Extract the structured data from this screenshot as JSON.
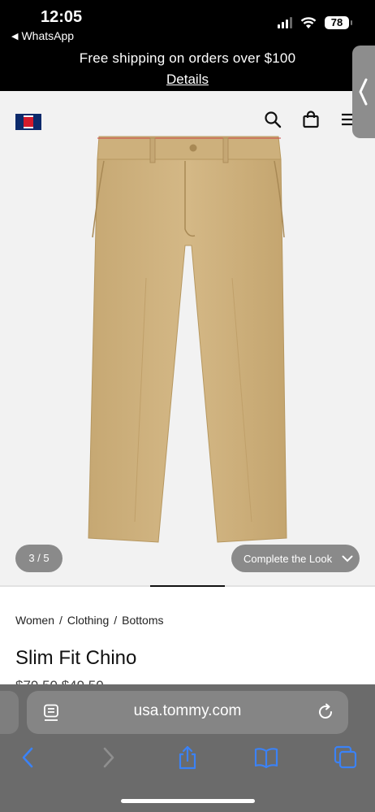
{
  "status_bar": {
    "time": "12:05",
    "back_app": "WhatsApp",
    "battery": "78"
  },
  "promo": {
    "message": "Free shipping on orders over $100",
    "link": "Details"
  },
  "gallery": {
    "counter": "3 / 5",
    "complete_look": "Complete the Look",
    "current_image": 3,
    "total_images": 5
  },
  "breadcrumb": {
    "items": [
      "Women",
      "Clothing",
      "Bottoms"
    ],
    "separator": "/"
  },
  "product": {
    "name": "Slim Fit Chino",
    "price_partial": "$79.50 $49.50"
  },
  "browser": {
    "url": "usa.tommy.com"
  },
  "icons": {
    "search": "search-icon",
    "bag": "shopping-bag-icon",
    "menu": "menu-icon",
    "reader": "reader-mode-icon",
    "reload": "reload-icon",
    "back": "back-arrow-icon",
    "forward": "forward-arrow-icon",
    "share": "share-icon",
    "bookmarks": "bookmarks-icon",
    "tabs": "tabs-icon"
  },
  "colors": {
    "brand_navy": "#0c2a6b",
    "brand_red": "#d31a2b",
    "khaki": "#cfb27e",
    "ios_blue": "#3b82f6"
  }
}
